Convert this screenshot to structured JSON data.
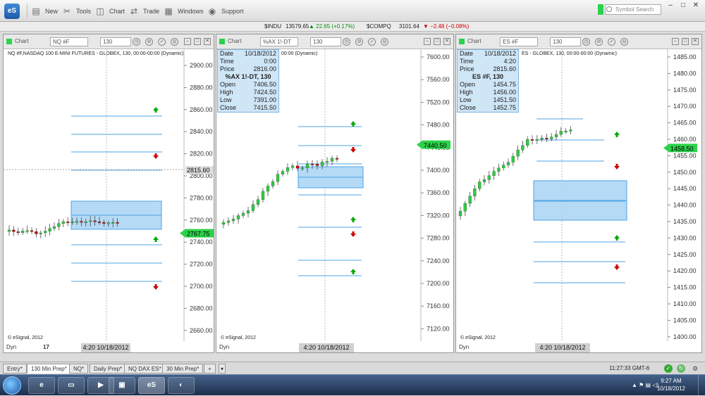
{
  "toolbar": {
    "new": "New",
    "tools": "Tools",
    "chart": "Chart",
    "trade": "Trade",
    "windows": "Windows",
    "support": "Support",
    "symbol_search_placeholder": "Symbol Search",
    "logo": "eS"
  },
  "ticker": {
    "indu_sym": "$INDU",
    "indu_last": "13579.65",
    "indu_chg": "▲ 22.65 (+0.17%)",
    "compq_sym": "$COMPQ",
    "compq_last": "3101.64",
    "compq_chg": "▼ −2.48 (−0.08%)"
  },
  "panels": [
    {
      "chart_label": "Chart",
      "symbol": "NQ #F",
      "interval": "130",
      "title": "NQ #F,NASDAQ 100 E-MINI FUTURES - GLOBEX, 130, 00:00-00:00 (Dynamic)",
      "axis": [
        "2900.00",
        "2880.00",
        "2860.00",
        "2840.00",
        "2820.00",
        "2800.00",
        "2780.00",
        "2760.00",
        "2740.00",
        "2720.00",
        "2700.00",
        "2680.00",
        "2660.00"
      ],
      "cursor_price": "2815.60",
      "last_price": "2767.75",
      "copyright": "© eSignal, 2012",
      "dyn": "Dyn",
      "day": "17",
      "time_label": "4:20 10/18/2012"
    },
    {
      "chart_label": "Chart",
      "symbol": "%AX 1!-DT",
      "interval": "130",
      "title": "00:00 (Dynamic)",
      "axis": [
        "7600.00",
        "7560.00",
        "7520.00",
        "7480.00",
        "7440.00",
        "7400.00",
        "7360.00",
        "7320.00",
        "7280.00",
        "7240.00",
        "7200.00",
        "7160.00",
        "7120.00"
      ],
      "last_price": "7440.50",
      "copyright": "© eSignal, 2012",
      "dyn": "Dyn",
      "time_label": "4:20 10/18/2012",
      "data_window": {
        "date_label": "Date",
        "date": "10/18/2012",
        "time_label": "Time",
        "time": "0:00",
        "price_label": "Price",
        "price": "2816.00",
        "header": "%AX 1!-DT, 130",
        "open_label": "Open",
        "open": "7406.50",
        "high_label": "High",
        "high": "7424.50",
        "low_label": "Low",
        "low": "7391.00",
        "close_label": "Close",
        "close": "7415.50"
      }
    },
    {
      "chart_label": "Chart",
      "symbol": "ES #F",
      "interval": "130",
      "title": "ES - GLOBEX, 130, 00:00-00:00 (Dynamic)",
      "axis": [
        "1485.00",
        "1480.00",
        "1475.00",
        "1470.00",
        "1465.00",
        "1460.00",
        "1455.00",
        "1450.00",
        "1445.00",
        "1440.00",
        "1435.00",
        "1430.00",
        "1425.00",
        "1420.00",
        "1415.00",
        "1410.00",
        "1405.00",
        "1400.00"
      ],
      "last_price": "1458.50",
      "copyright": "© eSignal, 2012",
      "dyn": "Dyn",
      "time_label": "4:20 10/18/2012",
      "data_window": {
        "date_label": "Date",
        "date": "10/18/2012",
        "time_label": "Time",
        "time": "4:20",
        "price_label": "Price",
        "price": "2815.60",
        "header": "ES #F, 130",
        "open_label": "Open",
        "open": "1454.75",
        "high_label": "High",
        "high": "1456.00",
        "low_label": "Low",
        "low": "1451.50",
        "close_label": "Close",
        "close": "1452.75"
      }
    }
  ],
  "tabs": [
    "Entry*",
    "130 Min Prep*",
    "NQ*",
    "Daily Prep*",
    "NQ DAX ES*",
    "30 Min Prep*"
  ],
  "status": {
    "time": "11:27:33 GMT-6"
  },
  "taskbar": {
    "time": "9:27 AM",
    "date": "10/18/2012",
    "app_es": "eS"
  },
  "colors": {
    "up_candle": "#2ecc40",
    "down_candle": "#cc0000",
    "level_line": "#4da3e6",
    "zone_fill": "#a8d4f4",
    "last_price_tag": "#2cd24a"
  }
}
